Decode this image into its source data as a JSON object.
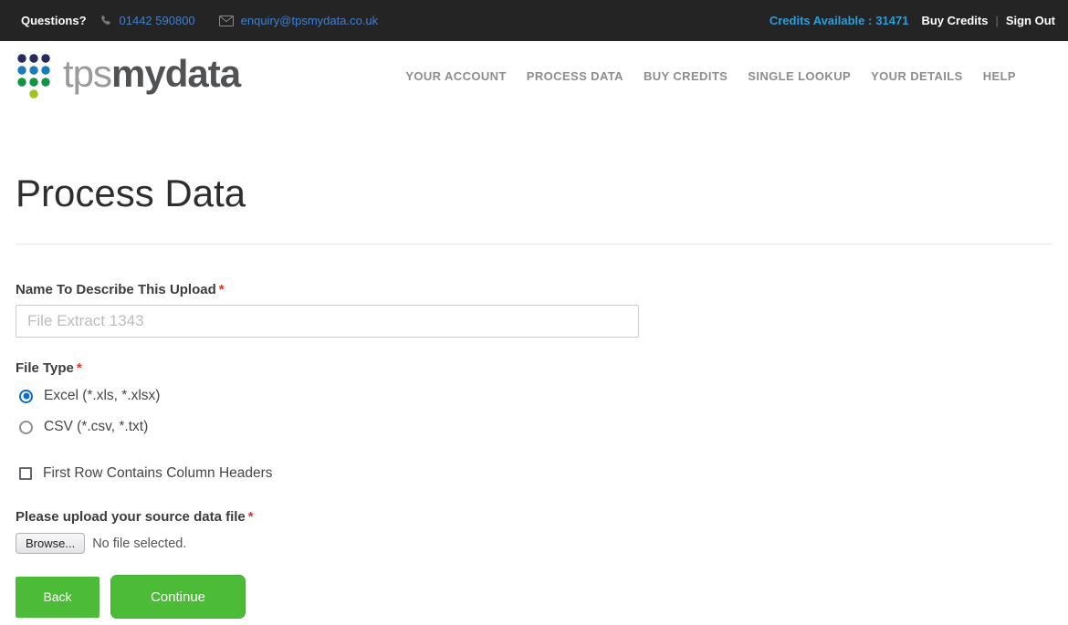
{
  "topbar": {
    "questions_label": "Questions?",
    "phone": "01442 590800",
    "email": "enquiry@tpsmydata.co.uk",
    "credits_label": "Credits Available :",
    "credits_value": "31471",
    "buy_credits": "Buy Credits",
    "separator": "|",
    "sign_out": "Sign Out"
  },
  "header": {
    "logo": {
      "prefix": "tps",
      "suffix": "mydata",
      "dot_colors": {
        "navy": "#27295f",
        "blue": "#1b79c0",
        "green": "#139346",
        "lime": "#9fc41c"
      }
    },
    "nav": [
      {
        "label": "YOUR ACCOUNT"
      },
      {
        "label": "PROCESS DATA"
      },
      {
        "label": "BUY CREDITS"
      },
      {
        "label": "SINGLE LOOKUP"
      },
      {
        "label": "YOUR DETAILS"
      },
      {
        "label": "HELP"
      }
    ]
  },
  "main": {
    "title": "Process Data",
    "form": {
      "name_label": "Name To Describe This Upload",
      "required_marker": "*",
      "name_placeholder": "File Extract 1343",
      "name_value": "",
      "file_type_label": "File Type",
      "file_types": [
        {
          "label": "Excel (*.xls, *.xlsx)",
          "selected": true
        },
        {
          "label": "CSV (*.csv, *.txt)",
          "selected": false
        }
      ],
      "header_checkbox_label": "First Row Contains Column Headers",
      "header_checkbox_checked": false,
      "upload_label": "Please upload your source data file",
      "browse_button": "Browse...",
      "no_file_text": "No file selected.",
      "back_button": "Back",
      "continue_button": "Continue"
    }
  },
  "colors": {
    "topbar_bg": "#242424",
    "link_blue": "#3f7fd2",
    "credits_blue": "#2d9dd8",
    "accent_green": "#4cbb38",
    "radio_blue": "#1469c8",
    "required_red": "#e0342e"
  }
}
